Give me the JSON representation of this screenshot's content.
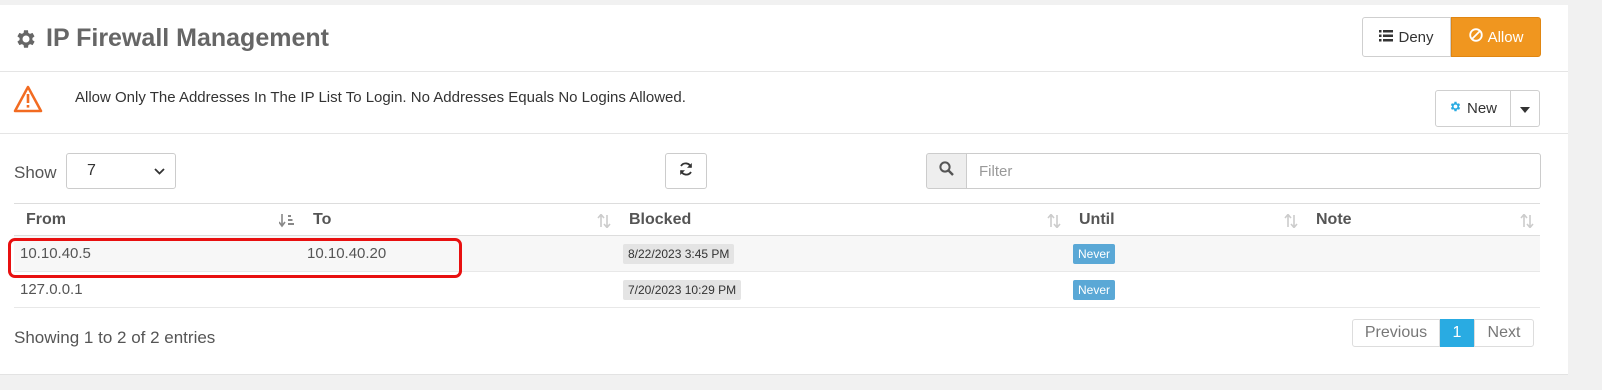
{
  "header": {
    "title": "IP Firewall Management",
    "title_icon": "gear-icon",
    "deny_label": "Deny",
    "deny_icon": "list-icon",
    "allow_label": "Allow",
    "allow_icon": "ban-icon",
    "accent_color": "#f0961f"
  },
  "alert": {
    "icon": "warning-triangle-icon",
    "text": "Allow Only The Addresses In The IP List To Login. No Addresses Equals No Logins Allowed.",
    "new_label": "New",
    "new_icon": "gear-icon"
  },
  "controls": {
    "show_label": "Show",
    "show_value": "7",
    "refresh_icon": "refresh-icon",
    "filter_icon": "search-icon",
    "filter_placeholder": "Filter"
  },
  "table": {
    "columns": [
      "From",
      "To",
      "Blocked",
      "Until",
      "Note"
    ],
    "rows": [
      {
        "from": "10.10.40.5",
        "to": "10.10.40.20",
        "blocked": "8/22/2023 3:45 PM",
        "until": "Never",
        "note": ""
      },
      {
        "from": "127.0.0.1",
        "to": "",
        "blocked": "7/20/2023 10:29 PM",
        "until": "Never",
        "note": ""
      }
    ],
    "badge_color": "#5aa8d6"
  },
  "footer": {
    "info": "Showing 1 to 2 of 2 entries",
    "prev_label": "Previous",
    "current_page": "1",
    "next_label": "Next",
    "page_color": "#29abe2"
  }
}
